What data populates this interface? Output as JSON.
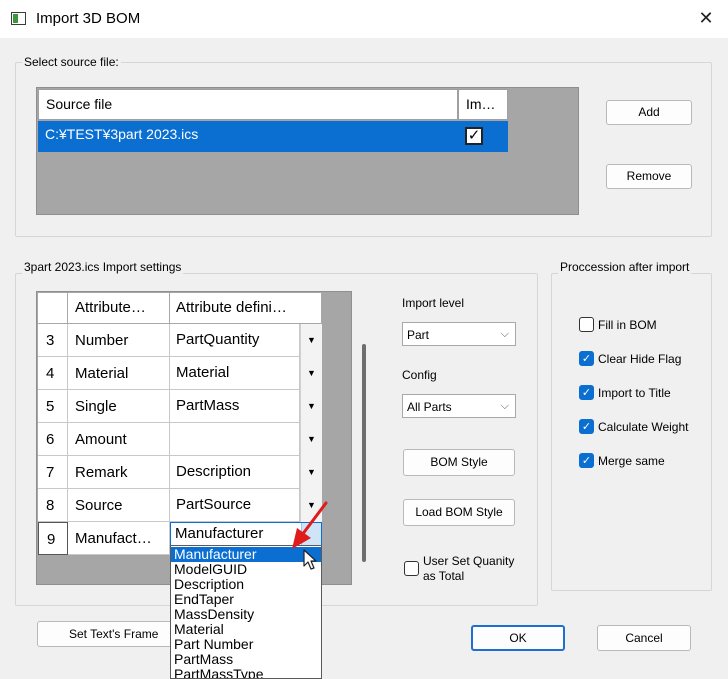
{
  "window": {
    "title": "Import 3D BOM",
    "close_glyph": "✕"
  },
  "source_group": {
    "title": "Select source file:",
    "columns": [
      "Source file",
      "Im…"
    ],
    "rows": [
      {
        "file": "C:¥TEST¥3part 2023.ics",
        "import": true
      }
    ],
    "add_label": "Add",
    "remove_label": "Remove"
  },
  "settings_group": {
    "title": "3part 2023.ics Import settings",
    "columns": [
      "Attribute…",
      "Attribute defini…"
    ],
    "rows": [
      {
        "num": "3",
        "attribute": "Number",
        "definition": "PartQuantity"
      },
      {
        "num": "4",
        "attribute": "Material",
        "definition": "Material"
      },
      {
        "num": "5",
        "attribute": "Single",
        "definition": "PartMass"
      },
      {
        "num": "6",
        "attribute": "Amount",
        "definition": ""
      },
      {
        "num": "7",
        "attribute": "Remark",
        "definition": "Description"
      },
      {
        "num": "8",
        "attribute": "Source",
        "definition": "PartSource"
      },
      {
        "num": "9",
        "attribute": "Manufact…",
        "definition": "Manufacturer"
      }
    ],
    "dropdown_glyph": "▼",
    "import_level_label": "Import level",
    "import_level_value": "Part",
    "config_label": "Config",
    "config_value": "All Parts",
    "chevron_glyph": "⌵",
    "bom_style_label": "BOM Style",
    "load_bom_style_label": "Load BOM Style",
    "user_set_quantity_label_1": "User Set Quanity",
    "user_set_quantity_label_2": "as Total"
  },
  "dropdown_list": {
    "items": [
      "Manufacturer",
      "ModelGUID",
      "Description",
      "EndTaper",
      "MassDensity",
      "Material",
      "Part Number",
      "PartMass",
      "PartMassType"
    ],
    "selected_index": 0
  },
  "procession_group": {
    "title": "Proccession after import",
    "options": [
      {
        "label": "Fill in BOM",
        "checked": false
      },
      {
        "label": "Clear Hide Flag",
        "checked": true
      },
      {
        "label": "Import to Title",
        "checked": true
      },
      {
        "label": "Calculate Weight",
        "checked": true
      },
      {
        "label": "Merge same",
        "checked": true
      }
    ],
    "check_glyph": "✓"
  },
  "footer": {
    "set_text_frame_label": "Set Text's Frame",
    "ok_label": "OK",
    "cancel_label": "Cancel"
  },
  "colors": {
    "selection": "#0a6fd1",
    "grid_background": "#a6a6a6",
    "annotation_arrow": "#e01b1b"
  }
}
